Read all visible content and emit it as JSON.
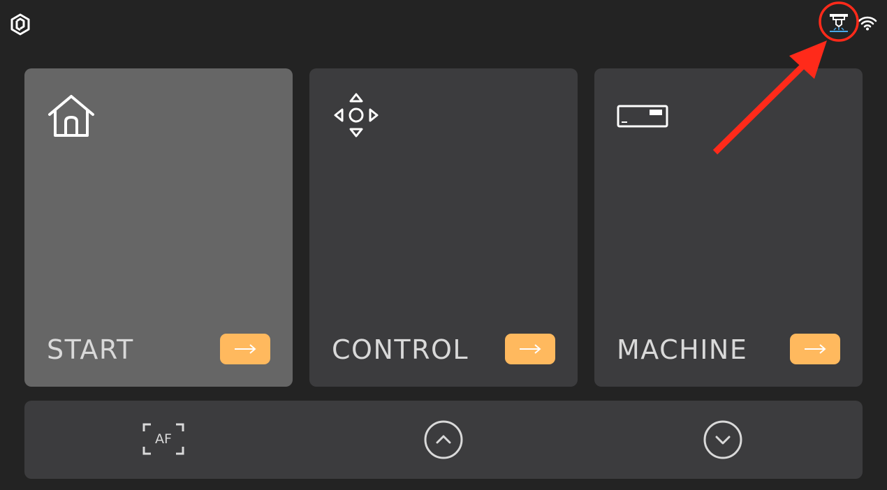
{
  "topbar": {
    "logo_icon": "app-logo-icon",
    "laser_icon": "laser-module-icon",
    "wifi_icon": "wifi-icon"
  },
  "cards": [
    {
      "label": "START",
      "icon": "home-icon",
      "arrow_icon": "arrow-right-icon",
      "active": true
    },
    {
      "label": "CONTROL",
      "icon": "directional-pad-icon",
      "arrow_icon": "arrow-right-icon",
      "active": false
    },
    {
      "label": "MACHINE",
      "icon": "machine-icon",
      "arrow_icon": "arrow-right-icon",
      "active": false
    }
  ],
  "bottom_bar": {
    "autofocus_label": "AF",
    "up_icon": "chevron-up-icon",
    "down_icon": "chevron-down-icon"
  },
  "colors": {
    "background": "#232323",
    "card": "#3c3c3e",
    "card_active": "#666666",
    "accent": "#ffb95e",
    "annotation": "#ff2a1a",
    "laser_blue": "#4aa8e8"
  }
}
